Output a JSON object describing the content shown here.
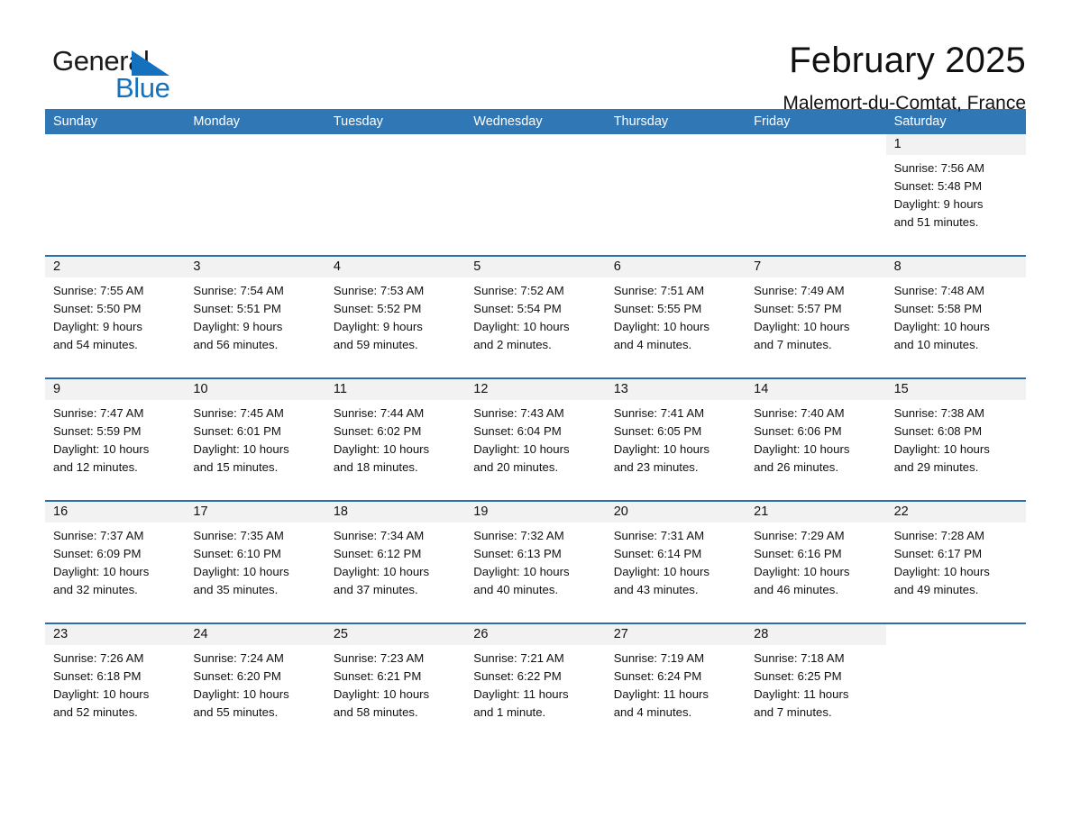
{
  "logo": {
    "word_one": "General",
    "word_two": "Blue",
    "triangle_color": "#1471bd"
  },
  "header": {
    "title": "February 2025",
    "subtitle": "Malemort-du-Comtat, France",
    "accent_color": "#3077b5",
    "row_border_color": "#2b6cab",
    "daynum_band_color": "#f2f2f2"
  },
  "weekdays": [
    "Sunday",
    "Monday",
    "Tuesday",
    "Wednesday",
    "Thursday",
    "Friday",
    "Saturday"
  ],
  "weeks": [
    {
      "days": [
        {
          "num": "",
          "sunrise": "",
          "sunset": "",
          "daylight_line1": "",
          "daylight_line2": "",
          "blank": true
        },
        {
          "num": "",
          "sunrise": "",
          "sunset": "",
          "daylight_line1": "",
          "daylight_line2": "",
          "blank": true
        },
        {
          "num": "",
          "sunrise": "",
          "sunset": "",
          "daylight_line1": "",
          "daylight_line2": "",
          "blank": true
        },
        {
          "num": "",
          "sunrise": "",
          "sunset": "",
          "daylight_line1": "",
          "daylight_line2": "",
          "blank": true
        },
        {
          "num": "",
          "sunrise": "",
          "sunset": "",
          "daylight_line1": "",
          "daylight_line2": "",
          "blank": true
        },
        {
          "num": "",
          "sunrise": "",
          "sunset": "",
          "daylight_line1": "",
          "daylight_line2": "",
          "blank": true
        },
        {
          "num": "1",
          "sunrise": "Sunrise: 7:56 AM",
          "sunset": "Sunset: 5:48 PM",
          "daylight_line1": "Daylight: 9 hours",
          "daylight_line2": "and 51 minutes."
        }
      ]
    },
    {
      "days": [
        {
          "num": "2",
          "sunrise": "Sunrise: 7:55 AM",
          "sunset": "Sunset: 5:50 PM",
          "daylight_line1": "Daylight: 9 hours",
          "daylight_line2": "and 54 minutes."
        },
        {
          "num": "3",
          "sunrise": "Sunrise: 7:54 AM",
          "sunset": "Sunset: 5:51 PM",
          "daylight_line1": "Daylight: 9 hours",
          "daylight_line2": "and 56 minutes."
        },
        {
          "num": "4",
          "sunrise": "Sunrise: 7:53 AM",
          "sunset": "Sunset: 5:52 PM",
          "daylight_line1": "Daylight: 9 hours",
          "daylight_line2": "and 59 minutes."
        },
        {
          "num": "5",
          "sunrise": "Sunrise: 7:52 AM",
          "sunset": "Sunset: 5:54 PM",
          "daylight_line1": "Daylight: 10 hours",
          "daylight_line2": "and 2 minutes."
        },
        {
          "num": "6",
          "sunrise": "Sunrise: 7:51 AM",
          "sunset": "Sunset: 5:55 PM",
          "daylight_line1": "Daylight: 10 hours",
          "daylight_line2": "and 4 minutes."
        },
        {
          "num": "7",
          "sunrise": "Sunrise: 7:49 AM",
          "sunset": "Sunset: 5:57 PM",
          "daylight_line1": "Daylight: 10 hours",
          "daylight_line2": "and 7 minutes."
        },
        {
          "num": "8",
          "sunrise": "Sunrise: 7:48 AM",
          "sunset": "Sunset: 5:58 PM",
          "daylight_line1": "Daylight: 10 hours",
          "daylight_line2": "and 10 minutes."
        }
      ]
    },
    {
      "days": [
        {
          "num": "9",
          "sunrise": "Sunrise: 7:47 AM",
          "sunset": "Sunset: 5:59 PM",
          "daylight_line1": "Daylight: 10 hours",
          "daylight_line2": "and 12 minutes."
        },
        {
          "num": "10",
          "sunrise": "Sunrise: 7:45 AM",
          "sunset": "Sunset: 6:01 PM",
          "daylight_line1": "Daylight: 10 hours",
          "daylight_line2": "and 15 minutes."
        },
        {
          "num": "11",
          "sunrise": "Sunrise: 7:44 AM",
          "sunset": "Sunset: 6:02 PM",
          "daylight_line1": "Daylight: 10 hours",
          "daylight_line2": "and 18 minutes."
        },
        {
          "num": "12",
          "sunrise": "Sunrise: 7:43 AM",
          "sunset": "Sunset: 6:04 PM",
          "daylight_line1": "Daylight: 10 hours",
          "daylight_line2": "and 20 minutes."
        },
        {
          "num": "13",
          "sunrise": "Sunrise: 7:41 AM",
          "sunset": "Sunset: 6:05 PM",
          "daylight_line1": "Daylight: 10 hours",
          "daylight_line2": "and 23 minutes."
        },
        {
          "num": "14",
          "sunrise": "Sunrise: 7:40 AM",
          "sunset": "Sunset: 6:06 PM",
          "daylight_line1": "Daylight: 10 hours",
          "daylight_line2": "and 26 minutes."
        },
        {
          "num": "15",
          "sunrise": "Sunrise: 7:38 AM",
          "sunset": "Sunset: 6:08 PM",
          "daylight_line1": "Daylight: 10 hours",
          "daylight_line2": "and 29 minutes."
        }
      ]
    },
    {
      "days": [
        {
          "num": "16",
          "sunrise": "Sunrise: 7:37 AM",
          "sunset": "Sunset: 6:09 PM",
          "daylight_line1": "Daylight: 10 hours",
          "daylight_line2": "and 32 minutes."
        },
        {
          "num": "17",
          "sunrise": "Sunrise: 7:35 AM",
          "sunset": "Sunset: 6:10 PM",
          "daylight_line1": "Daylight: 10 hours",
          "daylight_line2": "and 35 minutes."
        },
        {
          "num": "18",
          "sunrise": "Sunrise: 7:34 AM",
          "sunset": "Sunset: 6:12 PM",
          "daylight_line1": "Daylight: 10 hours",
          "daylight_line2": "and 37 minutes."
        },
        {
          "num": "19",
          "sunrise": "Sunrise: 7:32 AM",
          "sunset": "Sunset: 6:13 PM",
          "daylight_line1": "Daylight: 10 hours",
          "daylight_line2": "and 40 minutes."
        },
        {
          "num": "20",
          "sunrise": "Sunrise: 7:31 AM",
          "sunset": "Sunset: 6:14 PM",
          "daylight_line1": "Daylight: 10 hours",
          "daylight_line2": "and 43 minutes."
        },
        {
          "num": "21",
          "sunrise": "Sunrise: 7:29 AM",
          "sunset": "Sunset: 6:16 PM",
          "daylight_line1": "Daylight: 10 hours",
          "daylight_line2": "and 46 minutes."
        },
        {
          "num": "22",
          "sunrise": "Sunrise: 7:28 AM",
          "sunset": "Sunset: 6:17 PM",
          "daylight_line1": "Daylight: 10 hours",
          "daylight_line2": "and 49 minutes."
        }
      ]
    },
    {
      "days": [
        {
          "num": "23",
          "sunrise": "Sunrise: 7:26 AM",
          "sunset": "Sunset: 6:18 PM",
          "daylight_line1": "Daylight: 10 hours",
          "daylight_line2": "and 52 minutes."
        },
        {
          "num": "24",
          "sunrise": "Sunrise: 7:24 AM",
          "sunset": "Sunset: 6:20 PM",
          "daylight_line1": "Daylight: 10 hours",
          "daylight_line2": "and 55 minutes."
        },
        {
          "num": "25",
          "sunrise": "Sunrise: 7:23 AM",
          "sunset": "Sunset: 6:21 PM",
          "daylight_line1": "Daylight: 10 hours",
          "daylight_line2": "and 58 minutes."
        },
        {
          "num": "26",
          "sunrise": "Sunrise: 7:21 AM",
          "sunset": "Sunset: 6:22 PM",
          "daylight_line1": "Daylight: 11 hours",
          "daylight_line2": "and 1 minute."
        },
        {
          "num": "27",
          "sunrise": "Sunrise: 7:19 AM",
          "sunset": "Sunset: 6:24 PM",
          "daylight_line1": "Daylight: 11 hours",
          "daylight_line2": "and 4 minutes."
        },
        {
          "num": "28",
          "sunrise": "Sunrise: 7:18 AM",
          "sunset": "Sunset: 6:25 PM",
          "daylight_line1": "Daylight: 11 hours",
          "daylight_line2": "and 7 minutes."
        },
        {
          "num": "",
          "sunrise": "",
          "sunset": "",
          "daylight_line1": "",
          "daylight_line2": "",
          "blank": true
        }
      ]
    }
  ]
}
